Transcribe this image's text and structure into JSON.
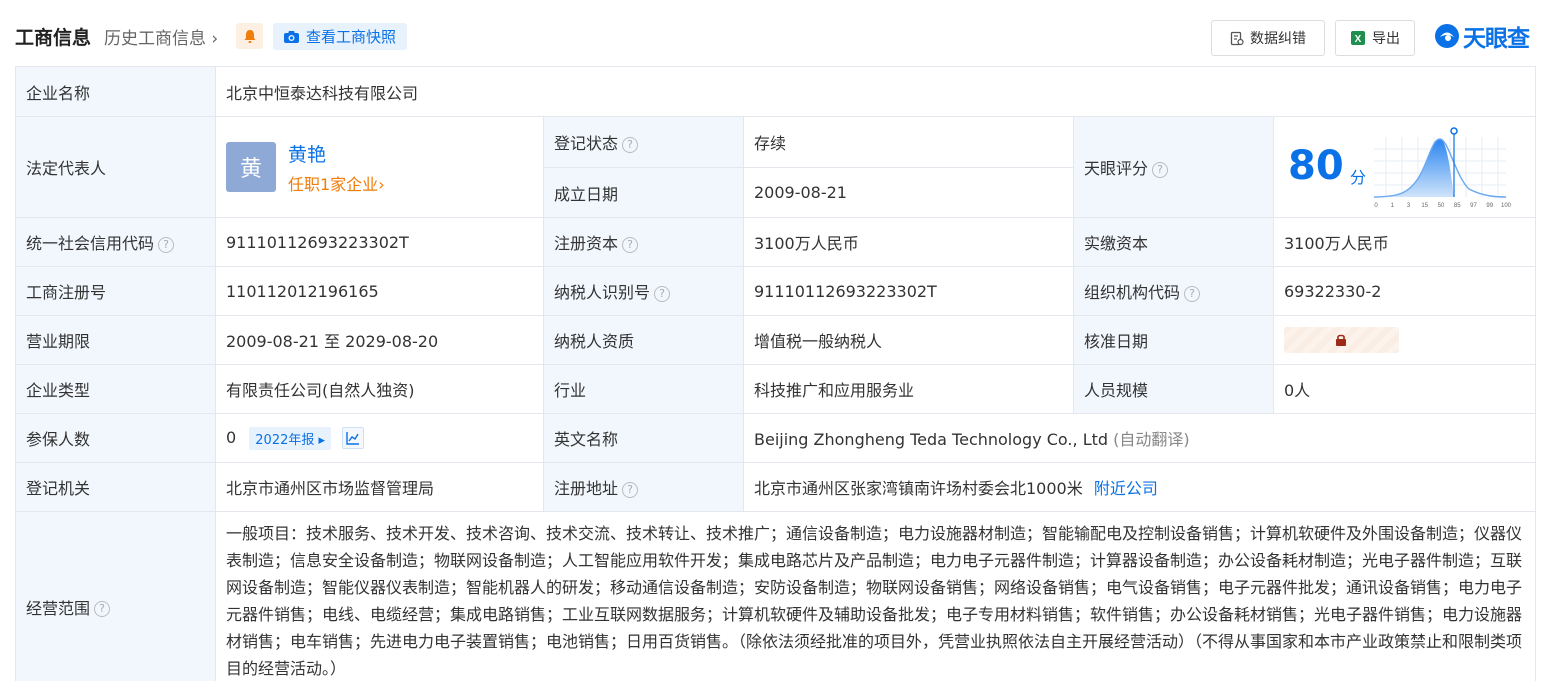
{
  "header": {
    "title": "工商信息",
    "history": "历史工商信息",
    "snapshot": "查看工商快照",
    "correct": "数据纠错",
    "export": "导出",
    "logo": "天眼查"
  },
  "company": {
    "name_label": "企业名称",
    "name": "北京中恒泰达科技有限公司",
    "rep_label": "法定代表人",
    "rep_avatar": "黄",
    "rep_name": "黄艳",
    "rep_position": "任职1家企业",
    "status_label": "登记状态",
    "status": "存续",
    "found_label": "成立日期",
    "found_date": "2009-08-21",
    "score_label": "天眼评分",
    "score": "80",
    "score_unit": "分",
    "score_ticks": [
      "0",
      "1",
      "3",
      "15",
      "50",
      "85",
      "97",
      "99",
      "100"
    ],
    "credit_label": "统一社会信用代码",
    "credit_code": "91110112693223302T",
    "reg_capital_label": "注册资本",
    "reg_capital": "3100万人民币",
    "paid_capital_label": "实缴资本",
    "paid_capital": "3100万人民币",
    "reg_no_label": "工商注册号",
    "reg_no": "110112012196165",
    "tax_id_label": "纳税人识别号",
    "tax_id": "91110112693223302T",
    "org_code_label": "组织机构代码",
    "org_code": "69322330-2",
    "term_label": "营业期限",
    "term": "2009-08-21 至 2029-08-20",
    "tax_qual_label": "纳税人资质",
    "tax_qual": "增值税一般纳税人",
    "approve_label": "核准日期",
    "type_label": "企业类型",
    "type": "有限责任公司(自然人独资)",
    "industry_label": "行业",
    "industry": "科技推广和应用服务业",
    "staff_label": "人员规模",
    "staff": "0人",
    "insured_label": "参保人数",
    "insured": "0",
    "insured_tag": "2022年报",
    "en_name_label": "英文名称",
    "en_name": "Beijing Zhongheng Teda Technology Co., Ltd",
    "en_name_note": "(自动翻译)",
    "authority_label": "登记机关",
    "authority": "北京市通州区市场监督管理局",
    "address_label": "注册地址",
    "address": "北京市通州区张家湾镇南许场村委会北1000米",
    "nearby": "附近公司",
    "scope_label": "经营范围",
    "scope": "一般项目：技术服务、技术开发、技术咨询、技术交流、技术转让、技术推广；通信设备制造；电力设施器材制造；智能输配电及控制设备销售；计算机软硬件及外围设备制造；仪器仪表制造；信息安全设备制造；物联网设备制造；人工智能应用软件开发；集成电路芯片及产品制造；电力电子元器件制造；计算器设备制造；办公设备耗材制造；光电子器件制造；互联网设备制造；智能仪器仪表制造；智能机器人的研发；移动通信设备制造；安防设备制造；物联网设备销售；网络设备销售；电气设备销售；电子元器件批发；通讯设备销售；电力电子元器件销售；电线、电缆经营；集成电路销售；工业互联网数据服务；计算机软硬件及辅助设备批发；电子专用材料销售；软件销售；办公设备耗材销售；光电子器件销售；电力设施器材销售；电车销售；先进电力电子装置销售；电池销售；日用百货销售。（除依法须经批准的项目外，凭营业执照依法自主开展经营活动）（不得从事国家和本市产业政策禁止和限制类项目的经营活动。）"
  },
  "colors": {
    "accent": "#0a72e6",
    "label_bg": "#f2f7fd",
    "status_green": "#1a9b3c",
    "orange": "#f07c0a"
  }
}
